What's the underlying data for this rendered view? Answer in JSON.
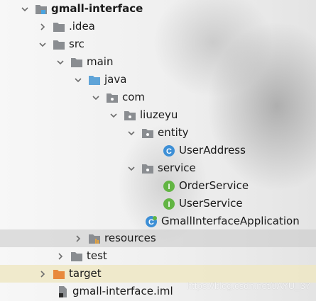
{
  "tree": {
    "project": "gmall-interface",
    "idea": ".idea",
    "src": "src",
    "main": "main",
    "java": "java",
    "com": "com",
    "liuzeyu": "liuzeyu",
    "entity": "entity",
    "user_address": "UserAddress",
    "service": "service",
    "order_service": "OrderService",
    "user_service": "UserService",
    "app": "GmallInterfaceApplication",
    "resources": "resources",
    "test": "test",
    "target": "target",
    "iml": "gmall-interface.iml"
  },
  "icons": {
    "class_letter": "C",
    "interface_letter": "I"
  },
  "watermark": "https://blog.csdn.net/JAYU_37",
  "colors": {
    "folder_gray": "#8a8d91",
    "folder_blue": "#5fa4d8",
    "folder_orange": "#e8893b",
    "class_blue": "#3d8fd6",
    "interface_green": "#62b543"
  }
}
